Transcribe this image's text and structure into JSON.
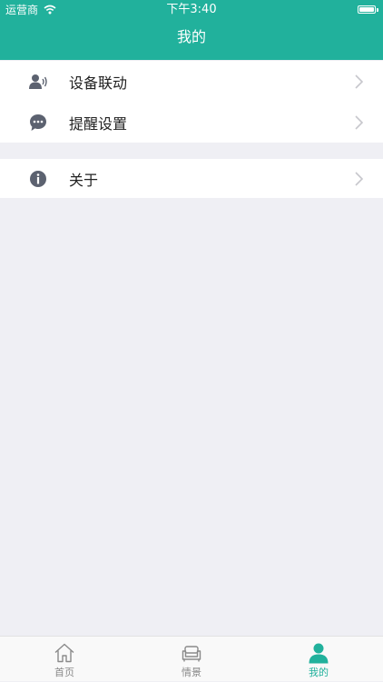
{
  "status_bar": {
    "carrier": "运营商",
    "time": "下午3:40"
  },
  "header": {
    "title": "我的"
  },
  "colors": {
    "accent": "#21b19c",
    "background": "#efeff4",
    "icon_gray": "#5c6270"
  },
  "menu": {
    "group1": [
      {
        "label": "设备联动",
        "icon": "person-voice-icon"
      },
      {
        "label": "提醒设置",
        "icon": "chat-bubble-icon"
      }
    ],
    "group2": [
      {
        "label": "关于",
        "icon": "info-icon"
      }
    ]
  },
  "tabbar": {
    "items": [
      {
        "label": "首页",
        "icon": "home-icon",
        "active": false
      },
      {
        "label": "情景",
        "icon": "sofa-icon",
        "active": false
      },
      {
        "label": "我的",
        "icon": "user-icon",
        "active": true
      }
    ]
  }
}
